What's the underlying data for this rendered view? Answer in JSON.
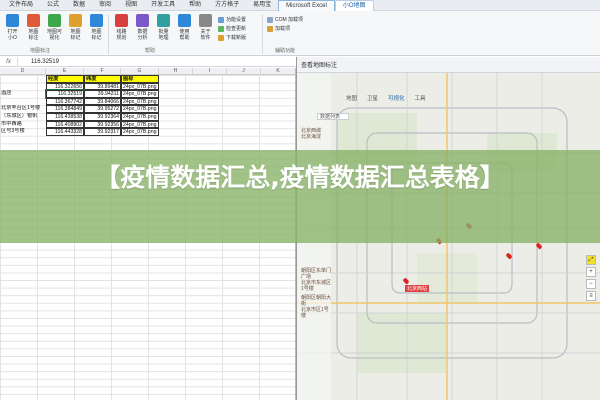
{
  "ribbon": {
    "tabs": [
      {
        "label": "文件布局"
      },
      {
        "label": "公式"
      },
      {
        "label": "数据"
      },
      {
        "label": "审阅"
      },
      {
        "label": "视图"
      },
      {
        "label": "开发工具"
      },
      {
        "label": "帮助"
      },
      {
        "label": "方方格子"
      },
      {
        "label": "易用宝"
      },
      {
        "label": "Microsoft Excel"
      },
      {
        "label": "小O地图"
      }
    ],
    "buttons": [
      {
        "label": "打开\n小O",
        "color": "#2f87d8"
      },
      {
        "label": "地图\n标注",
        "color": "#e05a3a"
      },
      {
        "label": "地图可\n视化",
        "color": "#3da84a"
      },
      {
        "label": "地图\n标记",
        "color": "#e0a030"
      },
      {
        "label": "地图\n标记",
        "color": "#2f87d8"
      },
      {
        "label": "线路\n规划",
        "color": "#d84040"
      },
      {
        "label": "数据\n分析",
        "color": "#7a58c8"
      },
      {
        "label": "批量\n地理",
        "color": "#30a0a0"
      },
      {
        "label": "使用\n帮助",
        "color": "#2f87d8"
      },
      {
        "label": "关于\n软件",
        "color": "#888888"
      }
    ],
    "small_items": [
      {
        "label": "功能设置"
      },
      {
        "label": "检查更新"
      },
      {
        "label": "下载新版"
      }
    ],
    "com_items": [
      {
        "label": "COM 加载项"
      },
      {
        "label": "加载项"
      }
    ],
    "groups": [
      {
        "label": "地图标注"
      },
      {
        "label": "帮助"
      },
      {
        "label": "辅助功能"
      }
    ]
  },
  "formula_bar": {
    "fx": "fx",
    "value": "116.32519"
  },
  "sheet": {
    "columns": [
      "D",
      "E",
      "F",
      "G",
      "H",
      "I",
      "J",
      "K"
    ],
    "header_row": {
      "name": "",
      "lng": "经度",
      "lat": "纬度",
      "icon": "图标"
    },
    "rows": [
      {
        "name": "",
        "lng": "116.322656",
        "lat": "39.89481",
        "icon": "24px_07B.png"
      },
      {
        "name": "酒店",
        "lng": "116.32519",
        "lat": "39.94311",
        "icon": "24px_07B.png"
      },
      {
        "name": "",
        "lng": "116.367742",
        "lat": "39.84066",
        "icon": "24px_07B.png"
      },
      {
        "name": "北京丰台区1号楼",
        "lng": "116.384849",
        "lat": "39.95272",
        "icon": "24px_07B.png"
      },
      {
        "name": "（东城区）银帆",
        "lng": "116.438538",
        "lat": "39.92364",
        "icon": "24px_07B.png"
      },
      {
        "name": "市中西路",
        "lng": "116.408902",
        "lat": "39.92356",
        "icon": "24px_07B.png"
      },
      {
        "name": "区号3号楼",
        "lng": "116.443328",
        "lat": "39.92317",
        "icon": "24px_07B.png"
      }
    ]
  },
  "map": {
    "title": "查看地图标注",
    "tabs": [
      {
        "label": "地图"
      },
      {
        "label": "卫星"
      },
      {
        "label": "可视化"
      },
      {
        "label": "工具"
      }
    ],
    "search_placeholder": "数据列表",
    "side_list_top": [
      "北京西城",
      "北京海淀"
    ],
    "side_list_mid": [
      "朝阳区东单门广场",
      "北京市东城区1号楼"
    ],
    "side_list_bottom": [
      "朝阳区朝阳大街",
      "北京市区1号楼"
    ],
    "marker_label": "北京西站"
  },
  "banner": {
    "title": "【疫情数据汇总,疫情数据汇总表格】",
    "bg_color": "#88b266"
  }
}
